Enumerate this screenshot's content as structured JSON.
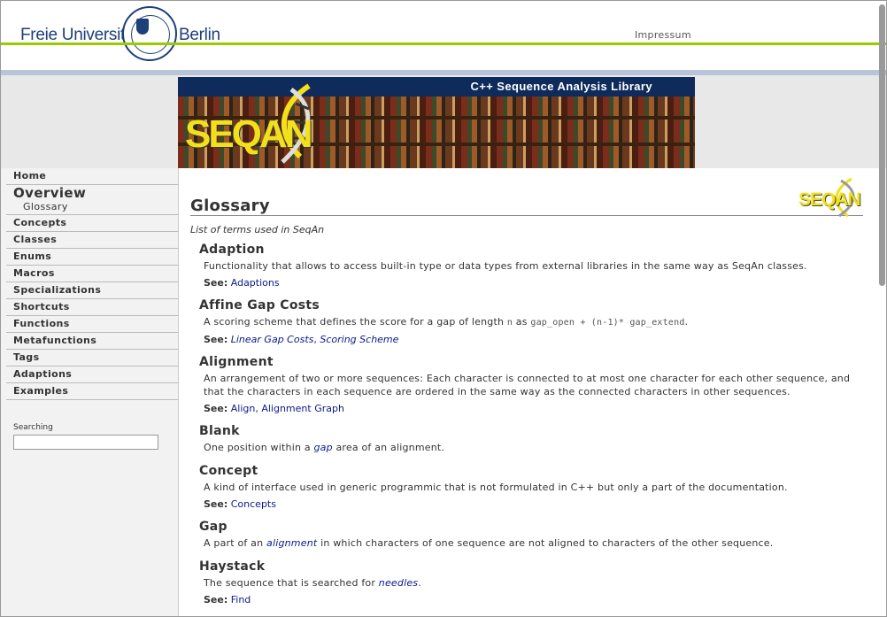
{
  "header": {
    "fu_left": "Freie Universität",
    "fu_right": "Berlin",
    "impressum": "Impressum"
  },
  "banner": {
    "title": "C++ Sequence Analysis Library",
    "logo_text": "SEQAN"
  },
  "sidebar": {
    "items": [
      {
        "label": "Home"
      },
      {
        "label": "Overview"
      },
      {
        "label": "Glossary"
      },
      {
        "label": "Concepts"
      },
      {
        "label": "Classes"
      },
      {
        "label": "Enums"
      },
      {
        "label": "Macros"
      },
      {
        "label": "Specializations"
      },
      {
        "label": "Shortcuts"
      },
      {
        "label": "Functions"
      },
      {
        "label": "Metafunctions"
      },
      {
        "label": "Tags"
      },
      {
        "label": "Adaptions"
      },
      {
        "label": "Examples"
      }
    ],
    "search_label": "Searching",
    "search_value": ""
  },
  "content": {
    "title": "Glossary",
    "intro": "List of terms used in SeqAn",
    "see_label": "See:",
    "small_logo": "SEQAN",
    "entries": [
      {
        "term": "Adaption",
        "def": "Functionality that allows to access built-in type or data types from external libraries in the same way as SeqAn classes.",
        "see": [
          "Adaptions"
        ]
      },
      {
        "term": "Affine Gap Costs",
        "def_a": "A scoring scheme that defines the score for a gap of length ",
        "def_code1": "n",
        "def_b": " as ",
        "def_code2": "gap_open + (n-1)* gap_extend",
        "def_c": ".",
        "see": [
          "Linear Gap Costs",
          "Scoring Scheme"
        ]
      },
      {
        "term": "Alignment",
        "def": "An arrangement of two or more sequences: Each character is connected to at most one character for each other sequence, and that the characters in each sequence are ordered in the same way as the connected characters in other sequences.",
        "see": [
          "Align",
          "Alignment Graph"
        ]
      },
      {
        "term": "Blank",
        "def_a": "One position within a ",
        "def_link": "gap",
        "def_b": " area of an alignment."
      },
      {
        "term": "Concept",
        "def": "A kind of interface used in generic programmic that is not formulated in C++ but only a part of the documentation.",
        "see": [
          "Concepts"
        ]
      },
      {
        "term": "Gap",
        "def_a": "A part of an ",
        "def_link": "alignment",
        "def_b": " in which characters of one sequence are not aligned to characters of the other sequence."
      },
      {
        "term": "Haystack",
        "def_a": "The sequence that is searched for ",
        "def_link": "needles",
        "def_b": ".",
        "see": [
          "Find"
        ]
      }
    ]
  }
}
